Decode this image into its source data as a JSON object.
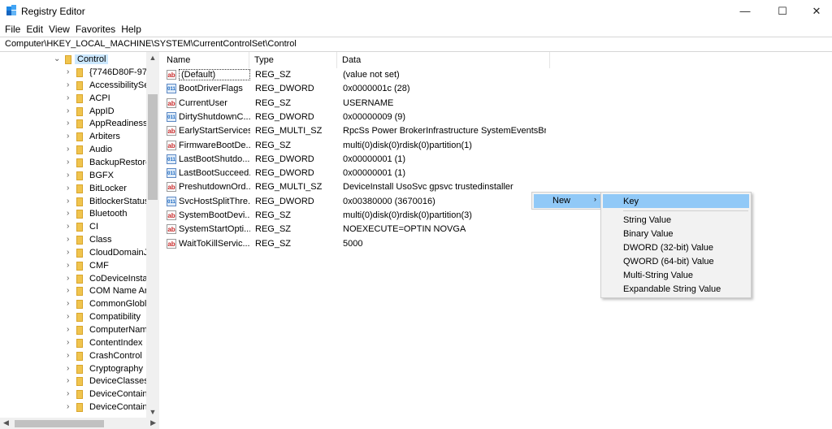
{
  "window": {
    "title": "Registry Editor",
    "minimize": "—",
    "maximize": "☐",
    "close": "✕"
  },
  "menu": [
    "File",
    "Edit",
    "View",
    "Favorites",
    "Help"
  ],
  "address": "Computer\\HKEY_LOCAL_MACHINE\\SYSTEM\\CurrentControlSet\\Control",
  "tree": {
    "selected": "Control",
    "items": [
      "{7746D80F-97E",
      "AccessibilitySe",
      "ACPI",
      "AppID",
      "AppReadiness",
      "Arbiters",
      "Audio",
      "BackupRestore",
      "BGFX",
      "BitLocker",
      "BitlockerStatus",
      "Bluetooth",
      "CI",
      "Class",
      "CloudDomainJ",
      "CMF",
      "CoDeviceInstal",
      "COM Name Ar",
      "CommonGlobl",
      "Compatibility",
      "ComputerNam",
      "ContentIndex",
      "CrashControl",
      "Cryptography",
      "DeviceClasses",
      "DeviceContain",
      "DeviceContain"
    ]
  },
  "columns": {
    "name": "Name",
    "type": "Type",
    "data": "Data"
  },
  "values": [
    {
      "name": "(Default)",
      "type": "REG_SZ",
      "data": "(value not set)",
      "icon": "string-value-icon"
    },
    {
      "name": "BootDriverFlags",
      "type": "REG_DWORD",
      "data": "0x0000001c (28)",
      "icon": "binary-value-icon"
    },
    {
      "name": "CurrentUser",
      "type": "REG_SZ",
      "data": "USERNAME",
      "icon": "string-value-icon"
    },
    {
      "name": "DirtyShutdownC...",
      "type": "REG_DWORD",
      "data": "0x00000009 (9)",
      "icon": "binary-value-icon"
    },
    {
      "name": "EarlyStartServices",
      "type": "REG_MULTI_SZ",
      "data": "RpcSs Power BrokerInfrastructure SystemEventsBro...",
      "icon": "string-value-icon"
    },
    {
      "name": "FirmwareBootDe...",
      "type": "REG_SZ",
      "data": "multi(0)disk(0)rdisk(0)partition(1)",
      "icon": "string-value-icon"
    },
    {
      "name": "LastBootShutdo...",
      "type": "REG_DWORD",
      "data": "0x00000001 (1)",
      "icon": "binary-value-icon"
    },
    {
      "name": "LastBootSucceed...",
      "type": "REG_DWORD",
      "data": "0x00000001 (1)",
      "icon": "binary-value-icon"
    },
    {
      "name": "PreshutdownOrd...",
      "type": "REG_MULTI_SZ",
      "data": "DeviceInstall UsoSvc gpsvc trustedinstaller",
      "icon": "string-value-icon"
    },
    {
      "name": "SvcHostSplitThre...",
      "type": "REG_DWORD",
      "data": "0x00380000 (3670016)",
      "icon": "binary-value-icon"
    },
    {
      "name": "SystemBootDevi...",
      "type": "REG_SZ",
      "data": "multi(0)disk(0)rdisk(0)partition(3)",
      "icon": "string-value-icon"
    },
    {
      "name": "SystemStartOpti...",
      "type": "REG_SZ",
      "data": " NOEXECUTE=OPTIN  NOVGA",
      "icon": "string-value-icon"
    },
    {
      "name": "WaitToKillServic...",
      "type": "REG_SZ",
      "data": "5000",
      "icon": "string-value-icon"
    }
  ],
  "context_menu": {
    "new_label": "New",
    "arrow": "›"
  },
  "submenu": [
    "Key",
    "String Value",
    "Binary Value",
    "DWORD (32-bit) Value",
    "QWORD (64-bit) Value",
    "Multi-String Value",
    "Expandable String Value"
  ]
}
